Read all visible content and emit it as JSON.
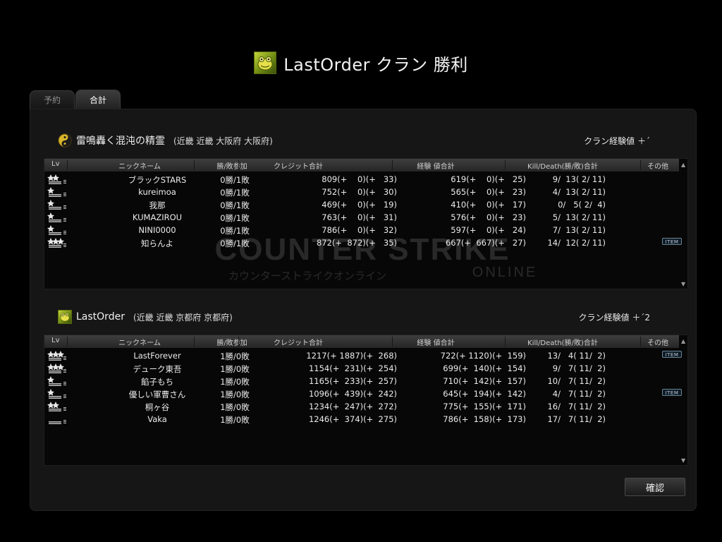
{
  "title": {
    "text": "LastOrder クラン 勝利"
  },
  "tabs": [
    {
      "label": "予約",
      "active": false
    },
    {
      "label": "合計",
      "active": true
    }
  ],
  "columns": {
    "lv": "Lv",
    "nickname": "ニックネーム",
    "win_loss": "勝/敗参加",
    "credit": "クレジット合計",
    "exp": "経験 値合計",
    "kd": "Kill/Death(勝/敗)合計",
    "other": "その他"
  },
  "clans": [
    {
      "name": "雷鳴轟く混沌の精霊",
      "region": "(近畿 近畿 大阪府 大阪府)",
      "exp_label": "クラン経験値 ＋´",
      "emblem": "yin-yang-icon",
      "players": [
        {
          "nick": "ブラックSTARS",
          "wl": "0勝/1敗",
          "credit": "809(+    0)(+   33)",
          "exp": "619(+    0)(+   25)",
          "kd": "9/  13( 2/ 11)",
          "item": ""
        },
        {
          "nick": "kureimoa",
          "wl": "0勝/1敗",
          "credit": "752(+    0)(+   30)",
          "exp": "565(+    0)(+   23)",
          "kd": "4/  13( 2/ 11)",
          "item": ""
        },
        {
          "nick": "我那",
          "wl": "0勝/1敗",
          "credit": "469(+    0)(+   19)",
          "exp": "410(+    0)(+   17)",
          "kd": "0/   5( 2/  4)",
          "item": ""
        },
        {
          "nick": "KUMAZIROU",
          "wl": "0勝/1敗",
          "credit": "763(+    0)(+   31)",
          "exp": "576(+    0)(+   23)",
          "kd": "5/  13( 2/ 11)",
          "item": ""
        },
        {
          "nick": "NINI0000",
          "wl": "0勝/1敗",
          "credit": "786(+    0)(+   32)",
          "exp": "597(+    0)(+   24)",
          "kd": "7/  13( 2/ 11)",
          "item": ""
        },
        {
          "nick": "知らんよ",
          "wl": "0勝/1敗",
          "credit": "872(+  872)(+   35)",
          "exp": "667(+  667)(+   27)",
          "kd": "14/  12( 2/ 11)",
          "item": "ITEM"
        }
      ]
    },
    {
      "name": "LastOrder",
      "region": "(近畿 近畿 京都府 京都府)",
      "exp_label": "クラン経験値 ＋´2",
      "emblem": "frog-emblem-icon",
      "players": [
        {
          "nick": "LastForever",
          "wl": "1勝/0敗",
          "credit": "1217(+ 1887)(+  268)",
          "exp": "722(+ 1120)(+  159)",
          "kd": "13/   4( 11/  2)",
          "item": "ITEM"
        },
        {
          "nick": "デューク東吾",
          "wl": "1勝/0敗",
          "credit": "1154(+  231)(+  254)",
          "exp": "699(+  140)(+  154)",
          "kd": "9/   7( 11/  2)",
          "item": ""
        },
        {
          "nick": "餡子もち",
          "wl": "1勝/0敗",
          "credit": "1165(+  233)(+  257)",
          "exp": "710(+  142)(+  157)",
          "kd": "10/   7( 11/  2)",
          "item": ""
        },
        {
          "nick": "優しい軍曹さん",
          "wl": "1勝/0敗",
          "credit": "1096(+  439)(+  242)",
          "exp": "645(+  194)(+  142)",
          "kd": "4/   7( 11/  2)",
          "item": "ITEM"
        },
        {
          "nick": "桐ヶ谷",
          "wl": "1勝/0敗",
          "credit": "1234(+  247)(+  272)",
          "exp": "775(+  155)(+  171)",
          "kd": "16/   7( 11/  2)",
          "item": ""
        },
        {
          "nick": "Vaka",
          "wl": "1勝/0敗",
          "credit": "1246(+  374)(+  275)",
          "exp": "786(+  158)(+  173)",
          "kd": "17/   7( 11/  2)",
          "item": ""
        }
      ]
    }
  ],
  "watermark": {
    "line1": "COUNTER STRIKE",
    "line2": "カウンターストライクオンライン",
    "line3": "ONLINE"
  },
  "confirm_label": "確認"
}
